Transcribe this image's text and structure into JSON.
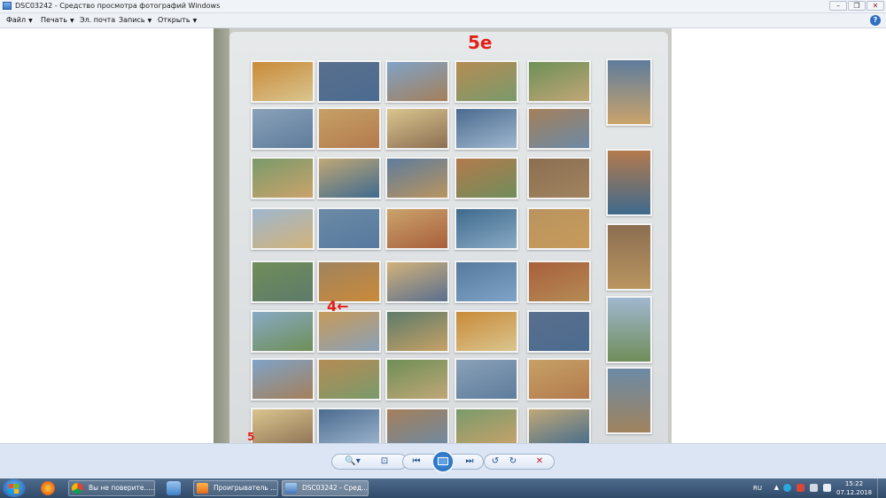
{
  "window": {
    "title": "DSC03242 - Средство просмотра фотографий Windows",
    "controls": {
      "minimize": "–",
      "maximize": "❐",
      "close": "✕"
    }
  },
  "menu": {
    "items": [
      {
        "label": "Файл",
        "arrow": "▼"
      },
      {
        "label": "Печать",
        "arrow": "▼"
      },
      {
        "label": "Эл. почта",
        "arrow": ""
      },
      {
        "label": "Запись",
        "arrow": "▼"
      },
      {
        "label": "Открыть",
        "arrow": "▼"
      }
    ],
    "help": "?"
  },
  "photo": {
    "annotations": {
      "top": "5е",
      "middle": "4←",
      "bottom": "5"
    },
    "card_colors": [
      "#c98a3a",
      "#5a6f8e",
      "#7fa3c7",
      "#b58b54",
      "#6e8f57",
      "#8aa1b8",
      "#c6a166",
      "#d9c58e",
      "#4b6b8f",
      "#a47f5a",
      "#7a9a6b",
      "#c0a777",
      "#5e7c9c",
      "#b37a4d",
      "#8c6f52",
      "#9fb7cf",
      "#6c8aa6",
      "#caa36b",
      "#3f6a8d",
      "#b9945f",
      "#708d5a",
      "#a0835e",
      "#d1b27a",
      "#56799e",
      "#a85f3c",
      "#88a9c4",
      "#c79a5a",
      "#5d7b6a"
    ]
  },
  "controls": {
    "zoom": "🔍▾",
    "fit": "⊡",
    "prev": "⏮",
    "next": "⏭",
    "rotate_ccw": "↺",
    "rotate_cw": "↻",
    "delete": "✕"
  },
  "taskbar": {
    "buttons": [
      {
        "label": "Вы не поверите......"
      },
      {
        "label": "Проигрыватель ..."
      },
      {
        "label": "DSC03242 - Сред..."
      }
    ],
    "lang": "RU",
    "time": "15:22",
    "date": "07.12.2018"
  }
}
